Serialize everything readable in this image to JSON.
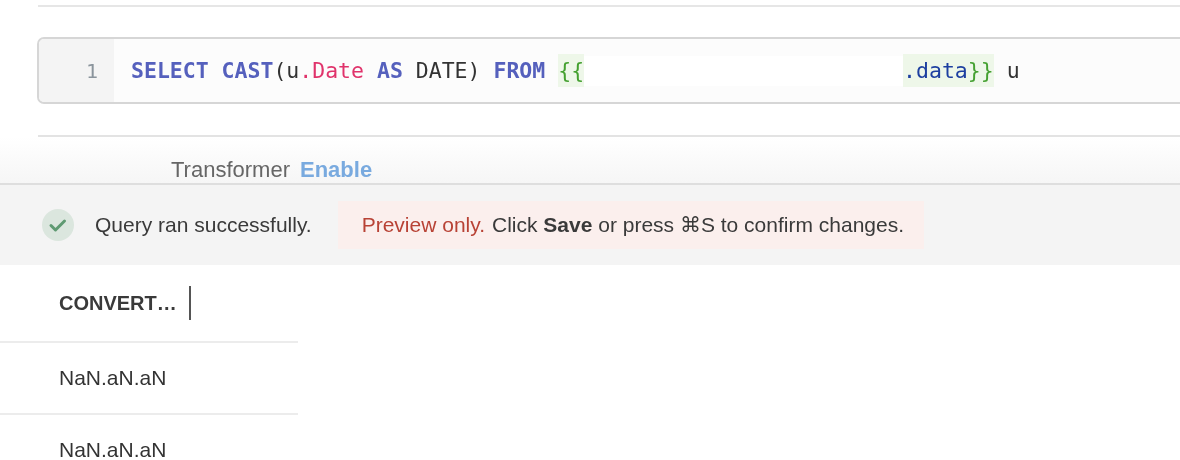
{
  "editor": {
    "line_number": "1",
    "tokens": [
      {
        "kind": "keyword",
        "text": "SELECT "
      },
      {
        "kind": "keyword",
        "text": "CAST"
      },
      {
        "kind": "plain",
        "text": "(u"
      },
      {
        "kind": "property",
        "text": ".Date "
      },
      {
        "kind": "keyword",
        "text": "AS"
      },
      {
        "kind": "plain",
        "text": " DATE) "
      },
      {
        "kind": "keyword",
        "text": "FROM "
      },
      {
        "kind": "template",
        "text": "{{"
      },
      {
        "kind": "redacted"
      },
      {
        "kind": "member",
        "text": ".data"
      },
      {
        "kind": "template",
        "text": "}}"
      },
      {
        "kind": "plain",
        "text": " u"
      }
    ]
  },
  "transformer": {
    "label": "Transformer",
    "action": "Enable"
  },
  "status": {
    "message": "Query ran successfully.",
    "notice_label": "Preview only.",
    "notice_text": "Click **Save** or press ⌘S to confirm changes."
  },
  "table": {
    "columns": [
      "CONVERT…"
    ],
    "rows": [
      [
        "NaN.aN.aN"
      ],
      [
        "NaN.aN.aN"
      ]
    ]
  }
}
